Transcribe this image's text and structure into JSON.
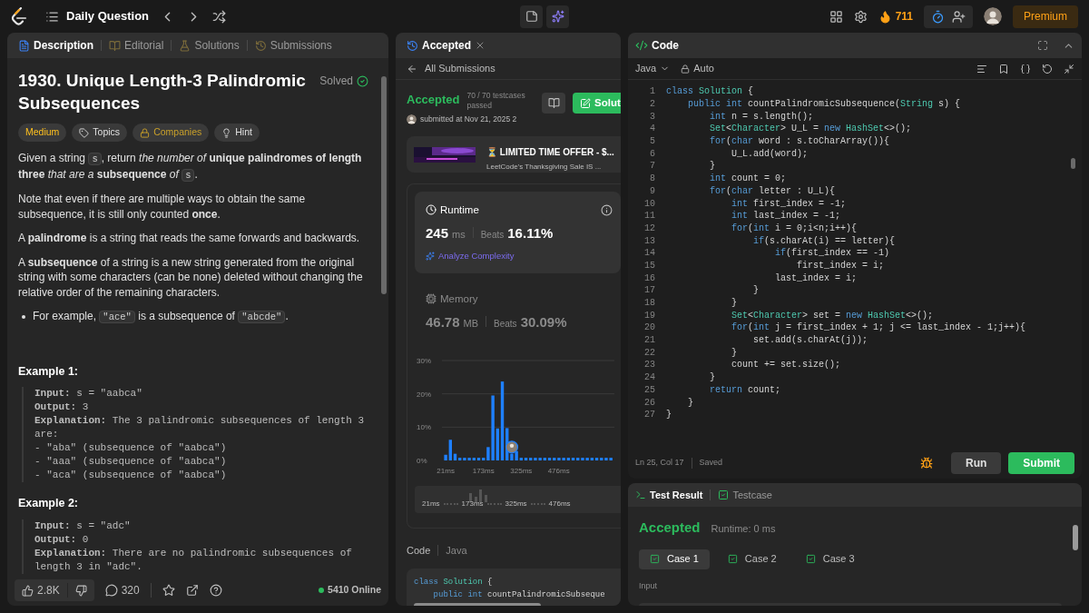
{
  "top_bar": {
    "title": "Daily Question",
    "streak": "711",
    "premium": "Premium"
  },
  "description_panel": {
    "tabs": [
      {
        "label": "Description",
        "selected": true
      },
      {
        "label": "Editorial",
        "selected": false
      },
      {
        "label": "Solutions",
        "selected": false
      },
      {
        "label": "Submissions",
        "selected": false
      }
    ],
    "title": "1930. Unique Length-3 Palindromic Subsequences",
    "status": "Solved",
    "tags": [
      {
        "label": "Medium",
        "kind": "difficulty"
      },
      {
        "label": "Topics",
        "kind": "topics"
      },
      {
        "label": "Companies",
        "kind": "companies"
      },
      {
        "label": "Hint",
        "kind": "hint"
      }
    ],
    "paragraphs": [
      {
        "kind": "text",
        "segments": [
          {
            "kind": "text",
            "text": "Given a string "
          },
          {
            "kind": "code",
            "text": "s"
          },
          {
            "kind": "text",
            "text": ", return *the number of* **unique palindromes of length three** *that are a* **subsequence** *of* "
          },
          {
            "kind": "code",
            "text": "s"
          },
          {
            "kind": "text",
            "text": "."
          }
        ]
      },
      {
        "kind": "text",
        "segments": [
          {
            "kind": "text",
            "text": "Note that even if there are multiple ways to obtain the same subsequence, it is still only counted **once**."
          }
        ]
      },
      {
        "kind": "text",
        "segments": [
          {
            "kind": "text",
            "text": "A **palindrome** is a string that reads the same forwards and backwards."
          }
        ]
      },
      {
        "kind": "text",
        "segments": [
          {
            "kind": "text",
            "text": "A **subsequence** of a string is a new string generated from the original string with some characters (can be none) deleted without changing the relative order of the remaining characters."
          }
        ]
      },
      {
        "kind": "bullet",
        "segments": [
          {
            "kind": "text",
            "text": "For example, "
          },
          {
            "kind": "code",
            "text": "\"ace\""
          },
          {
            "kind": "text",
            "text": " is a subsequence of "
          },
          {
            "kind": "code",
            "text": "\"abcde\""
          },
          {
            "kind": "text",
            "text": "."
          }
        ]
      }
    ],
    "examples": [
      {
        "heading": "Example 1:",
        "lines": [
          "**Input:** s = \"aabca\"",
          "**Output:** 3",
          "**Explanation:** The 3 palindromic subsequences of length 3 are:",
          "- \"aba\" (subsequence of \"aabca\")",
          "- \"aaa\" (subsequence of \"aabca\")",
          "- \"aca\" (subsequence of \"aabca\")"
        ]
      },
      {
        "heading": "Example 2:",
        "lines": [
          "**Input:** s = \"adc\"",
          "**Output:** 0",
          "**Explanation:** There are no palindromic subsequences of length 3 in \"adc\"."
        ]
      }
    ],
    "footer": {
      "likes": "2.8K",
      "comments": "320",
      "online": "5410 Online"
    }
  },
  "submission_panel": {
    "tab": "Accepted",
    "back": "All Submissions",
    "status": "Accepted",
    "testcases": "70 / 70 testcases passed",
    "submitted": "submitted at Nov 21, 2025 2",
    "solution_button": "Solut",
    "ad": {
      "title": "⏳ LIMITED TIME OFFER - $...",
      "subtitle": "LeetCode's Thanksgiving Sale IS ..."
    },
    "metrics": [
      {
        "kind": "runtime",
        "label": "Runtime",
        "value": "245",
        "unit": "ms",
        "beats_label": "Beats",
        "beats": "16.11%",
        "action": "Analyze Complexity",
        "selected": true
      },
      {
        "kind": "memory",
        "label": "Memory",
        "value": "46.78",
        "unit": "MB",
        "beats_label": "Beats",
        "beats": "30.09%",
        "selected": false
      }
    ],
    "chart_data": {
      "type": "bar",
      "x": [
        21,
        40,
        59,
        78,
        97,
        116,
        135,
        154,
        173,
        192,
        211,
        230,
        249,
        268,
        287,
        306,
        325,
        344,
        363,
        382,
        401,
        420,
        439,
        458,
        477,
        496,
        515,
        534,
        553,
        572,
        591,
        610,
        629,
        648,
        667,
        686
      ],
      "values": [
        1.7,
        6.2,
        2,
        0.8,
        0.8,
        0.8,
        0.8,
        0.8,
        0.8,
        4,
        19.5,
        9.6,
        23.7,
        9.7,
        2,
        2.8,
        0.8,
        0.8,
        0.8,
        0.8,
        0.8,
        0.8,
        0.8,
        0.8,
        0.8,
        0.8,
        0.8,
        0.8,
        0.8,
        0.8,
        0.8,
        0.8,
        0.8,
        0.8,
        0.8,
        0.8
      ],
      "xlim": [
        6,
        700
      ],
      "ylim": [
        0,
        30
      ],
      "yticks": [
        {
          "value": 0,
          "label": "0%"
        },
        {
          "value": 10,
          "label": "10%"
        },
        {
          "value": 20,
          "label": "20%"
        },
        {
          "value": 30,
          "label": "30%"
        }
      ],
      "xticks": [
        {
          "value": 21,
          "label": "21ms"
        },
        {
          "value": 173,
          "label": "173ms"
        },
        {
          "value": 325,
          "label": "325ms"
        },
        {
          "value": 476,
          "label": "476ms"
        }
      ]
    },
    "minimap_labels": [
      "21ms",
      "173ms",
      "325ms",
      "476ms"
    ],
    "code_label": "Code",
    "language": "Java",
    "code_lines": [
      [
        {
          "kind": "kw",
          "text": "class "
        },
        {
          "kind": "ty",
          "text": "Solution"
        },
        {
          "kind": "p",
          "text": " {"
        }
      ],
      [
        {
          "kind": "kw",
          "text": "    public int "
        },
        {
          "kind": "p",
          "text": "countPalindromicSubseque"
        }
      ]
    ]
  },
  "editor": {
    "title": "Code",
    "language": "Java",
    "mode": "Auto",
    "lines": [
      {
        "n": "1",
        "seg": [
          {
            "kind": "kw",
            "text": "class "
          },
          {
            "kind": "ty",
            "text": "Solution"
          },
          {
            "kind": "p",
            "text": " {"
          }
        ]
      },
      {
        "n": "2",
        "seg": [
          {
            "kind": "kw",
            "text": "    public int "
          },
          {
            "kind": "p",
            "text": "countPalindromicSubsequence("
          },
          {
            "kind": "ty",
            "text": "String"
          },
          {
            "kind": "p",
            "text": " s) {"
          }
        ]
      },
      {
        "n": "3",
        "seg": [
          {
            "kind": "kw",
            "text": "        int "
          },
          {
            "kind": "p",
            "text": "n = s.length();"
          }
        ]
      },
      {
        "n": "4",
        "seg": [
          {
            "kind": "ty",
            "text": "        Set"
          },
          {
            "kind": "p",
            "text": "<"
          },
          {
            "kind": "ty",
            "text": "Character"
          },
          {
            "kind": "p",
            "text": "> U_L = "
          },
          {
            "kind": "kw",
            "text": "new "
          },
          {
            "kind": "ty",
            "text": "HashSet"
          },
          {
            "kind": "p",
            "text": "<>();"
          }
        ]
      },
      {
        "n": "5",
        "seg": [
          {
            "kind": "kw",
            "text": "        for"
          },
          {
            "kind": "p",
            "text": "("
          },
          {
            "kind": "kw",
            "text": "char "
          },
          {
            "kind": "p",
            "text": "word : s.toCharArray()){"
          }
        ]
      },
      {
        "n": "6",
        "seg": [
          {
            "kind": "p",
            "text": "            U_L.add(word);"
          }
        ]
      },
      {
        "n": "7",
        "seg": [
          {
            "kind": "p",
            "text": "        }"
          }
        ]
      },
      {
        "n": "8",
        "seg": [
          {
            "kind": "kw",
            "text": "        int "
          },
          {
            "kind": "p",
            "text": "count = 0;"
          }
        ]
      },
      {
        "n": "9",
        "seg": [
          {
            "kind": "kw",
            "text": "        for"
          },
          {
            "kind": "p",
            "text": "("
          },
          {
            "kind": "kw",
            "text": "char "
          },
          {
            "kind": "p",
            "text": "letter : U_L){"
          }
        ]
      },
      {
        "n": "10",
        "seg": [
          {
            "kind": "kw",
            "text": "            int "
          },
          {
            "kind": "p",
            "text": "first_index = -1;"
          }
        ]
      },
      {
        "n": "11",
        "seg": [
          {
            "kind": "kw",
            "text": "            int "
          },
          {
            "kind": "p",
            "text": "last_index = -1;"
          }
        ]
      },
      {
        "n": "12",
        "seg": [
          {
            "kind": "kw",
            "text": "            for"
          },
          {
            "kind": "p",
            "text": "("
          },
          {
            "kind": "kw",
            "text": "int "
          },
          {
            "kind": "p",
            "text": "i = 0;i<n;i++){"
          }
        ]
      },
      {
        "n": "13",
        "seg": [
          {
            "kind": "kw",
            "text": "                if"
          },
          {
            "kind": "p",
            "text": "(s.charAt(i) == letter){"
          }
        ]
      },
      {
        "n": "14",
        "seg": [
          {
            "kind": "kw",
            "text": "                    if"
          },
          {
            "kind": "p",
            "text": "(first_index == -1)"
          }
        ]
      },
      {
        "n": "15",
        "seg": [
          {
            "kind": "p",
            "text": "                        first_index = i;"
          }
        ]
      },
      {
        "n": "16",
        "seg": [
          {
            "kind": "p",
            "text": "                    last_index = i;"
          }
        ]
      },
      {
        "n": "17",
        "seg": [
          {
            "kind": "p",
            "text": "                }"
          }
        ]
      },
      {
        "n": "18",
        "seg": [
          {
            "kind": "p",
            "text": "            }"
          }
        ]
      },
      {
        "n": "19",
        "seg": [
          {
            "kind": "ty",
            "text": "            Set"
          },
          {
            "kind": "p",
            "text": "<"
          },
          {
            "kind": "ty",
            "text": "Character"
          },
          {
            "kind": "p",
            "text": "> set = "
          },
          {
            "kind": "kw",
            "text": "new "
          },
          {
            "kind": "ty",
            "text": "HashSet"
          },
          {
            "kind": "p",
            "text": "<>();"
          }
        ]
      },
      {
        "n": "20",
        "seg": [
          {
            "kind": "kw",
            "text": "            for"
          },
          {
            "kind": "p",
            "text": "("
          },
          {
            "kind": "kw",
            "text": "int "
          },
          {
            "kind": "p",
            "text": "j = first_index + 1; j <= last_index - 1;j++){"
          }
        ]
      },
      {
        "n": "21",
        "seg": [
          {
            "kind": "p",
            "text": "                set.add(s.charAt(j));"
          }
        ]
      },
      {
        "n": "22",
        "seg": [
          {
            "kind": "p",
            "text": "            }"
          }
        ]
      },
      {
        "n": "23",
        "seg": [
          {
            "kind": "p",
            "text": "            count += set.size();"
          }
        ]
      },
      {
        "n": "24",
        "seg": [
          {
            "kind": "p",
            "text": "        }"
          }
        ]
      },
      {
        "n": "25",
        "seg": [
          {
            "kind": "kw",
            "text": "        return "
          },
          {
            "kind": "p",
            "text": "count;"
          }
        ]
      },
      {
        "n": "26",
        "seg": [
          {
            "kind": "p",
            "text": "    }"
          }
        ]
      },
      {
        "n": "27",
        "seg": [
          {
            "kind": "p",
            "text": "}"
          }
        ]
      }
    ],
    "status": "Ln 25, Col 17",
    "saved": "Saved",
    "run": "Run",
    "submit": "Submit"
  },
  "test_panel": {
    "tabs": [
      {
        "label": "Test Result",
        "selected": true
      },
      {
        "label": "Testcase",
        "selected": false
      }
    ],
    "result": "Accepted",
    "runtime": "Runtime: 0 ms",
    "cases": [
      {
        "label": "Case 1",
        "selected": true,
        "passed": true
      },
      {
        "label": "Case 2",
        "selected": false,
        "passed": true
      },
      {
        "label": "Case 3",
        "selected": false,
        "passed": true
      }
    ],
    "input_label": "Input"
  }
}
